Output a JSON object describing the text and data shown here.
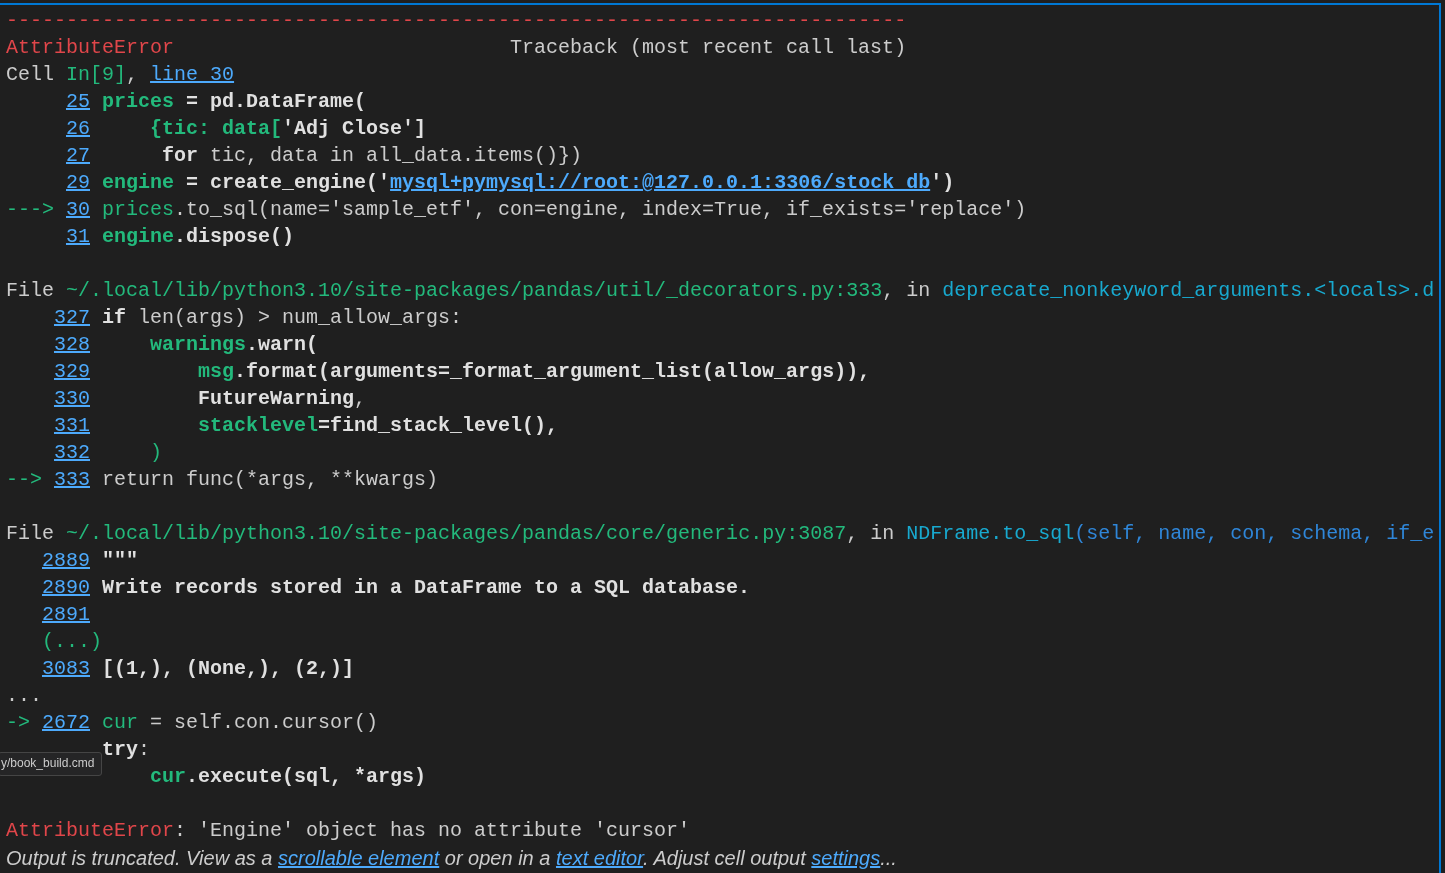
{
  "rows": [
    {
      "kind": "dashes",
      "text": "---------------------------------------------------------------------------"
    },
    {
      "kind": "header",
      "error": "AttributeError",
      "title": "Traceback (most recent call last)"
    },
    {
      "kind": "cell",
      "segments": [
        {
          "kind": "plain",
          "text": "Cell "
        },
        {
          "kind": "source",
          "text": "In[9]"
        },
        {
          "kind": "plain",
          "text": ", "
        },
        {
          "kind": "link",
          "text": "line 30"
        }
      ]
    },
    {
      "kind": "code",
      "number": "25",
      "segments": [
        {
          "kind": "variable",
          "text": "prices"
        },
        {
          "kind": "code",
          "text": " = pd.DataFrame("
        }
      ]
    },
    {
      "kind": "code",
      "number": "26",
      "segments": [
        {
          "kind": "variable",
          "text": "    {tic: data["
        },
        {
          "kind": "code",
          "text": "'Adj Close']"
        }
      ]
    },
    {
      "kind": "code",
      "number": "27",
      "segments": [
        {
          "kind": "code",
          "text": "     for"
        },
        {
          "kind": "plain",
          "text": " tic, data in all_data.items()})"
        }
      ]
    },
    {
      "kind": "code",
      "number": "29",
      "segments": [
        {
          "kind": "variable",
          "text": "engine"
        },
        {
          "kind": "code",
          "text": " = create_engine('"
        },
        {
          "kind": "url",
          "text": "mysql+pymysql://root:@127.0.0.1:3306/stock_db"
        },
        {
          "kind": "code",
          "text": "')"
        }
      ]
    },
    {
      "kind": "code",
      "arrow": "--->",
      "number": "30",
      "segments": [
        {
          "kind": "source",
          "text": "prices"
        },
        {
          "kind": "plain",
          "text": ".to_sql(name='sample_etf', con=engine, index=True, if_exists='replace')"
        }
      ]
    },
    {
      "kind": "code",
      "number": "31",
      "segments": [
        {
          "kind": "variable",
          "text": "engine"
        },
        {
          "kind": "code",
          "text": ".dispose()"
        }
      ]
    },
    {
      "kind": "blank"
    },
    {
      "kind": "frame",
      "segments": [
        {
          "kind": "plain",
          "text": "File "
        },
        {
          "kind": "source",
          "text": "~/.local/lib/python3.10/site-packages/pandas/util/_decorators.py:333"
        },
        {
          "kind": "plain",
          "text": ", in "
        },
        {
          "kind": "function",
          "text": "deprecate_nonkeyword_arguments.<locals>.d"
        }
      ]
    },
    {
      "kind": "code",
      "number": "327",
      "segments": [
        {
          "kind": "code",
          "text": "if"
        },
        {
          "kind": "plain",
          "text": " len(args) > num_allow_args:"
        }
      ]
    },
    {
      "kind": "code",
      "number": "328",
      "segments": [
        {
          "kind": "variable",
          "text": "    warnings"
        },
        {
          "kind": "code",
          "text": ".warn("
        }
      ]
    },
    {
      "kind": "code",
      "number": "329",
      "segments": [
        {
          "kind": "variable",
          "text": "        msg"
        },
        {
          "kind": "code",
          "text": ".format(arguments=_format_argument_list(allow_args)),"
        }
      ]
    },
    {
      "kind": "code",
      "number": "330",
      "segments": [
        {
          "kind": "code",
          "text": "        FutureWarning"
        },
        {
          "kind": "plain",
          "text": ","
        }
      ]
    },
    {
      "kind": "code",
      "number": "331",
      "segments": [
        {
          "kind": "variable",
          "text": "        stacklevel"
        },
        {
          "kind": "code",
          "text": "=find_stack_level(),"
        }
      ]
    },
    {
      "kind": "code",
      "number": "332",
      "segments": [
        {
          "kind": "source",
          "text": "    )"
        }
      ]
    },
    {
      "kind": "code",
      "arrow": "-->",
      "number": "333",
      "segments": [
        {
          "kind": "plain",
          "text": "return func(*args, **kwargs)"
        }
      ]
    },
    {
      "kind": "blank"
    },
    {
      "kind": "frame",
      "segments": [
        {
          "kind": "plain",
          "text": "File "
        },
        {
          "kind": "source",
          "text": "~/.local/lib/python3.10/site-packages/pandas/core/generic.py:3087"
        },
        {
          "kind": "plain",
          "text": ", in "
        },
        {
          "kind": "function",
          "text": "NDFrame.to_sql"
        },
        {
          "kind": "args",
          "text": "(self, name, con, schema, if_e"
        }
      ]
    },
    {
      "kind": "code",
      "number": "2889",
      "segments": [
        {
          "kind": "code",
          "text": "\"\"\""
        }
      ]
    },
    {
      "kind": "code",
      "number": "2890",
      "segments": [
        {
          "kind": "code",
          "text": "Write records stored in a DataFrame to a SQL database."
        }
      ]
    },
    {
      "kind": "code",
      "number": "2891"
    },
    {
      "kind": "skip",
      "text": "(...)"
    },
    {
      "kind": "code",
      "number": "3083",
      "segments": [
        {
          "kind": "code",
          "text": "[(1,), (None,), (2,)]"
        }
      ]
    },
    {
      "kind": "ellipsis",
      "text": "..."
    },
    {
      "kind": "code",
      "arrow": "->",
      "number": "2672",
      "segments": [
        {
          "kind": "source",
          "text": "cur"
        },
        {
          "kind": "plain",
          "text": " = self.con.cursor()"
        }
      ]
    },
    {
      "kind": "code",
      "segments": [
        {
          "kind": "code",
          "text": "try"
        },
        {
          "kind": "plain",
          "text": ":"
        }
      ]
    },
    {
      "kind": "code",
      "segments": [
        {
          "kind": "variable",
          "text": "    cur"
        },
        {
          "kind": "code",
          "text": ".execute(sql, *args)"
        }
      ]
    },
    {
      "kind": "blank"
    },
    {
      "kind": "error",
      "segments": [
        {
          "kind": "error",
          "text": "AttributeError"
        },
        {
          "kind": "plain",
          "text": ": 'Engine' object has no attribute 'cursor'"
        }
      ]
    }
  ],
  "note": [
    {
      "kind": "plain",
      "text": "Output is truncated. View as a "
    },
    {
      "kind": "link",
      "text": "scrollable element"
    },
    {
      "kind": "plain",
      "text": " or open in a "
    },
    {
      "kind": "link",
      "text": "text editor"
    },
    {
      "kind": "plain",
      "text": ". Adjust cell output "
    },
    {
      "kind": "link",
      "text": "settings"
    },
    {
      "kind": "plain",
      "text": "..."
    }
  ],
  "tooltip": "y/book_build.cmd"
}
